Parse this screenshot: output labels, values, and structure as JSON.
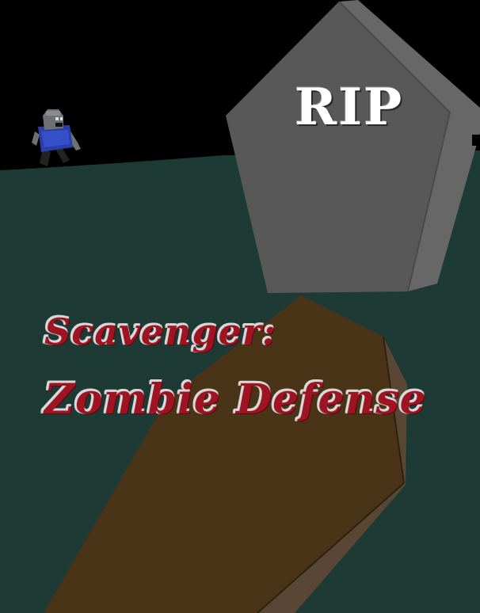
{
  "game": {
    "title_line1": "Scavenger:",
    "title_line2": "Zombie Defense",
    "tombstone_text": "RIP"
  },
  "colors": {
    "sky": "#000000",
    "ground": "#1e3a35",
    "tombstone_front": "#585858",
    "tombstone_side": "#676767",
    "coffin_top": "#4a3418",
    "coffin_side": "#5a4634",
    "title_red": "#9e1422",
    "zombie_skin": "#6e7174",
    "zombie_shirt": "#2b3ea8"
  },
  "icons": {
    "character": "zombie-sprite",
    "grave": "tombstone",
    "box": "coffin"
  }
}
